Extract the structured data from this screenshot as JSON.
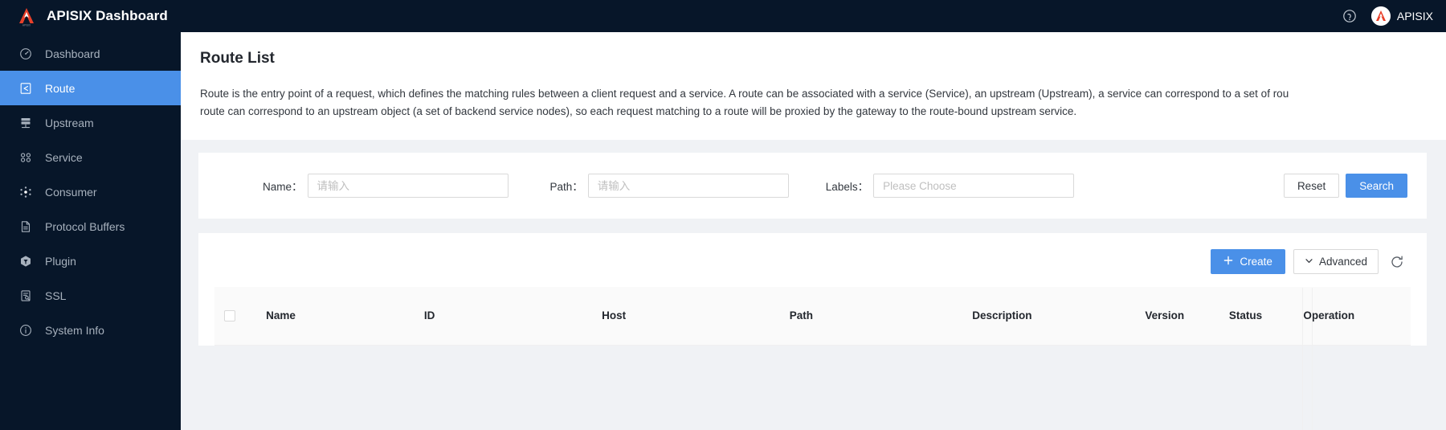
{
  "brand": {
    "title": "APISIX Dashboard",
    "logo_icon": "apisix-logo-icon"
  },
  "header": {
    "help_icon": "question-circle-icon",
    "user_name": "APISIX",
    "avatar_icon": "apisix-avatar-icon"
  },
  "sidebar": {
    "items": [
      {
        "label": "Dashboard",
        "icon": "dashboard-icon",
        "active": false
      },
      {
        "label": "Route",
        "icon": "route-icon",
        "active": true
      },
      {
        "label": "Upstream",
        "icon": "upstream-icon",
        "active": false
      },
      {
        "label": "Service",
        "icon": "service-icon",
        "active": false
      },
      {
        "label": "Consumer",
        "icon": "consumer-icon",
        "active": false
      },
      {
        "label": "Protocol Buffers",
        "icon": "file-icon",
        "active": false
      },
      {
        "label": "Plugin",
        "icon": "plugin-icon",
        "active": false
      },
      {
        "label": "SSL",
        "icon": "ssl-icon",
        "active": false
      },
      {
        "label": "System Info",
        "icon": "info-circle-icon",
        "active": false
      }
    ]
  },
  "page": {
    "title": "Route List",
    "description_line1": "Route is the entry point of a request, which defines the matching rules between a client request and a service. A route can be associated with a service (Service), an upstream (Upstream), a service can correspond to a set of rou",
    "description_line2": "route can correspond to an upstream object (a set of backend service nodes), so each request matching to a route will be proxied by the gateway to the route-bound upstream service."
  },
  "search": {
    "name_label": "Name：",
    "name_value": "",
    "name_placeholder": "请输入",
    "path_label": "Path：",
    "path_value": "",
    "path_placeholder": "请输入",
    "labels_label": "Labels：",
    "labels_value": "",
    "labels_placeholder": "Please Choose",
    "reset_label": "Reset",
    "search_label": "Search"
  },
  "toolbar": {
    "create_label": "Create",
    "create_icon": "plus-icon",
    "advanced_label": "Advanced",
    "advanced_icon": "chevron-down-icon",
    "refresh_icon": "refresh-icon"
  },
  "table": {
    "columns": [
      "Name",
      "ID",
      "Host",
      "Path",
      "Description",
      "Version",
      "Status",
      "Operation"
    ]
  },
  "colors": {
    "sidebar_bg": "#071629",
    "accent": "#4a90e8",
    "logo_red": "#e8402a",
    "page_bg": "#f0f2f5"
  }
}
